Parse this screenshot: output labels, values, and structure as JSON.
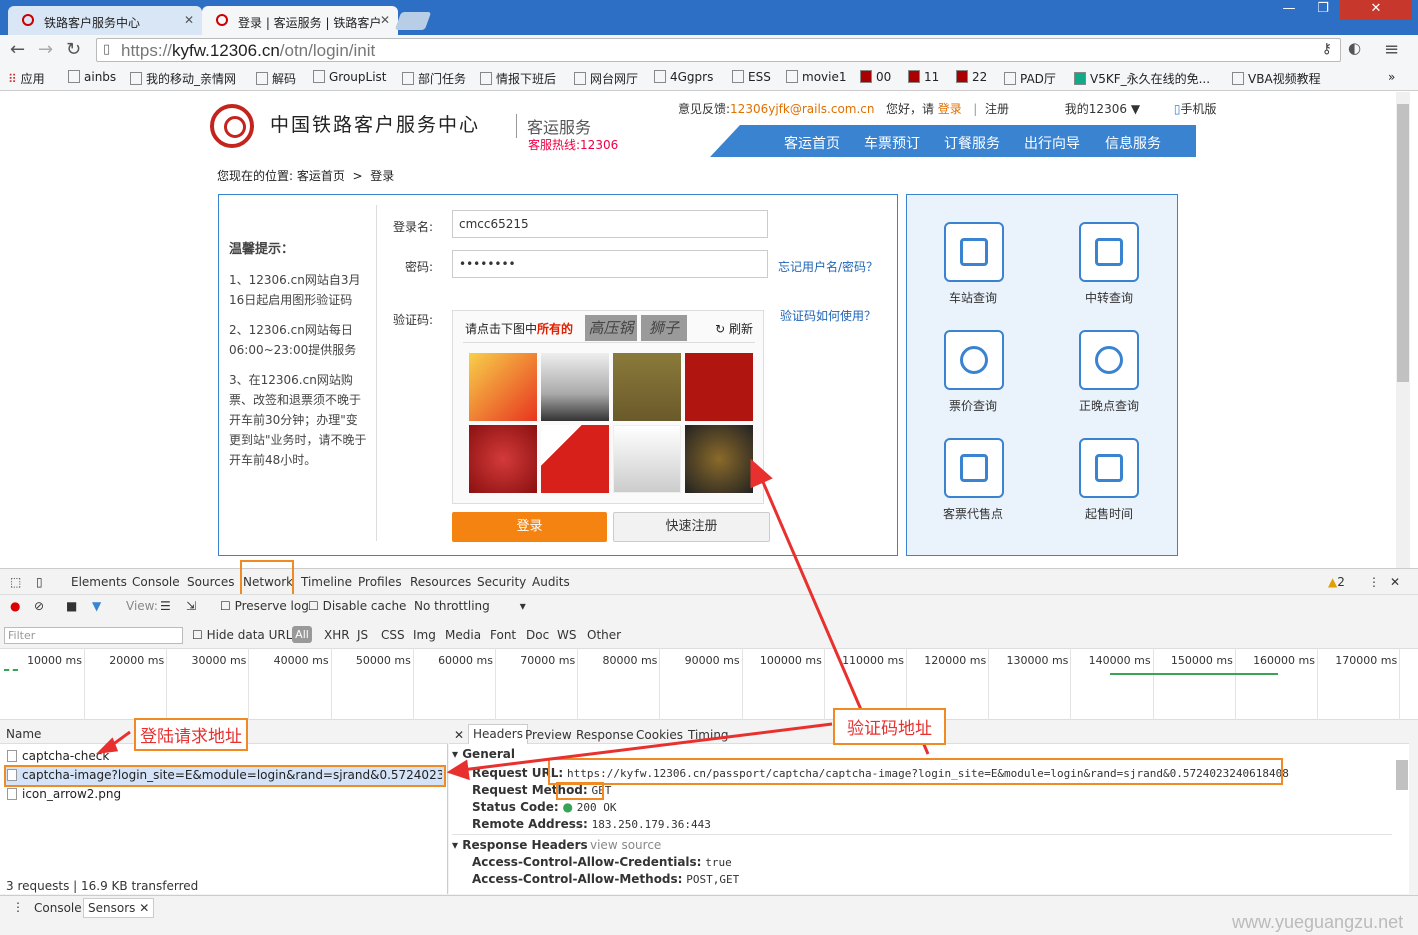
{
  "browser": {
    "tabs": [
      {
        "label": "铁路客户服务中心",
        "active": false
      },
      {
        "label": "登录 | 客运服务 | 铁路客户",
        "active": true
      }
    ],
    "url_prefix": "https://",
    "url_host": "kyfw.12306.cn",
    "url_path": "/otn/login/init",
    "bookmarks": [
      "应用",
      "ainbs",
      "我的移动_亲情网",
      "解码",
      "GroupList",
      "部门任务",
      "情报下班后",
      "网台网厅",
      "4Ggprs",
      "ESS",
      "movie1",
      "00",
      "11",
      "22",
      "PAD厅",
      "V5KF_永久在线的免...",
      "VBA视频教程"
    ],
    "bookmarks_more": "»"
  },
  "site": {
    "title": "中国铁路客户服务中心",
    "subtitle": "客运服务",
    "hotline": "客服热线:12306",
    "feedback_label": "意见反馈:",
    "feedback_email": "12306yjfk@rails.com.cn",
    "greeting": "您好，请",
    "login_link": "登录",
    "sep": "|",
    "register_link": "注册",
    "my12306": "我的12306",
    "mobile": "手机版",
    "nav": [
      "客运首页",
      "车票预订",
      "订餐服务",
      "出行向导",
      "信息服务"
    ],
    "breadcrumb": {
      "label": "您现在的位置:",
      "home": "客运首页",
      "sep": ">",
      "current": "登录"
    }
  },
  "login": {
    "tips_title": "温馨提示：",
    "tips": [
      "1、12306.cn网站自3月16日起启用图形验证码",
      "2、12306.cn网站每日06:00~23:00提供服务",
      "3、在12306.cn网站购票、改签和退票须不晚于开车前30分钟；办理\"变更到站\"业务时，请不晚于开车前48小时。"
    ],
    "username_label": "登录名:",
    "username_value": "cmcc65215",
    "password_label": "密码:",
    "password_value": "••••••••",
    "forgot_link": "忘记用户名/密码？",
    "captcha_label": "验证码:",
    "captcha_help": "验证码如何使用？",
    "captcha_prompt": "请点击下图中",
    "captcha_prompt_bold": "所有的",
    "captcha_words": [
      "高压锅",
      "狮子"
    ],
    "refresh": "刷新",
    "login_button": "登录",
    "register_button": "快速注册"
  },
  "quick_links": [
    "车站查询",
    "中转查询",
    "票价查询",
    "正晚点查询",
    "客票代售点",
    "起售时间"
  ],
  "devtools": {
    "tabs": [
      "Elements",
      "Console",
      "Sources",
      "Network",
      "Timeline",
      "Profiles",
      "Resources",
      "Security",
      "Audits"
    ],
    "warning_count": "2",
    "toolbar": {
      "view": "View:",
      "preserve_log": "Preserve log",
      "disable_cache": "Disable cache",
      "throttling": "No throttling"
    },
    "filter_placeholder": "Filter",
    "hide_data_urls": "Hide data URLs",
    "types": [
      "All",
      "XHR",
      "JS",
      "CSS",
      "Img",
      "Media",
      "Font",
      "Doc",
      "WS",
      "Other"
    ],
    "timeline_ticks": [
      "10000 ms",
      "20000 ms",
      "30000 ms",
      "40000 ms",
      "50000 ms",
      "60000 ms",
      "70000 ms",
      "80000 ms",
      "90000 ms",
      "100000 ms",
      "110000 ms",
      "120000 ms",
      "130000 ms",
      "140000 ms",
      "150000 ms",
      "160000 ms",
      "170000 ms"
    ],
    "name_header": "Name",
    "requests": [
      "captcha-check",
      "captcha-image?login_site=E&module=login&rand=sjrand&0.5724023240618...",
      "icon_arrow2.png"
    ],
    "status_bar": "3 requests  |  16.9 KB transferred",
    "detail_tabs": [
      "Headers",
      "Preview",
      "Response",
      "Cookies",
      "Timing"
    ],
    "general_title": "General",
    "general": [
      {
        "k": "Request URL:",
        "v": "https://kyfw.12306.cn/passport/captcha/captcha-image?login_site=E&module=login&rand=sjrand&0.5724023240618408"
      },
      {
        "k": "Request Method:",
        "v": "GET"
      },
      {
        "k": "Status Code:",
        "v": "200 OK"
      },
      {
        "k": "Remote Address:",
        "v": "183.250.179.36:443"
      }
    ],
    "response_headers_title": "Response Headers",
    "view_source": "view source",
    "response_headers": [
      {
        "k": "Access-Control-Allow-Credentials:",
        "v": "true"
      },
      {
        "k": "Access-Control-Allow-Methods:",
        "v": "POST,GET"
      }
    ],
    "drawer_tabs": [
      "Console",
      "Sensors"
    ]
  },
  "annotations": {
    "login_request": "登陆请求地址",
    "captcha_address": "验证码地址"
  },
  "watermark": "www.yueguangzu.net",
  "colors": {
    "accent": "#3a83d1",
    "annotation": "#f08a24",
    "annotation_text": "#e8302e",
    "login_button": "#f48312"
  }
}
